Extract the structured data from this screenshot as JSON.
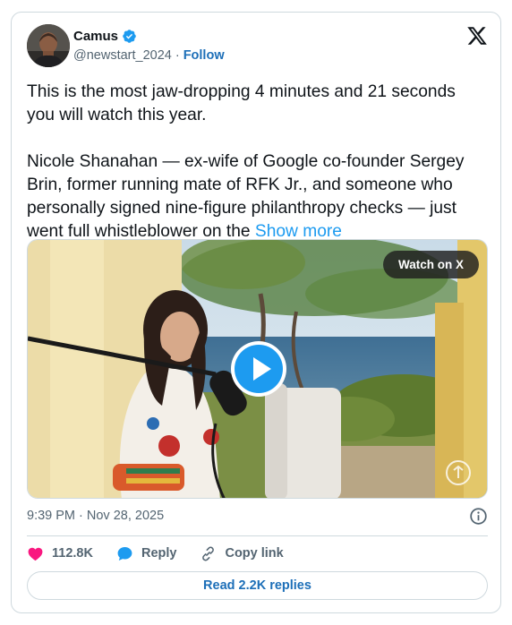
{
  "author": {
    "display_name": "Camus",
    "handle": "@newstart_2024",
    "separator": "·",
    "follow_label": "Follow",
    "verified_color": "#1d9bf0"
  },
  "tweet": {
    "line1": "This is the most jaw-dropping 4 minutes and 21 seconds you will watch this year.",
    "line2": "Nicole Shanahan — ex-wife of Google co-founder Sergey Brin, former running mate of RFK Jr., and someone who personally signed nine-figure philanthropy checks — just went full whistleblower on the",
    "show_more": "Show more"
  },
  "media": {
    "watch_label": "Watch on X",
    "play_color": "#1d9bf0"
  },
  "meta": {
    "timestamp": "9:39 PM · Nov 28, 2025"
  },
  "actions": {
    "likes": "112.8K",
    "reply_label": "Reply",
    "copy_link_label": "Copy link",
    "read_replies_label": "Read 2.2K replies"
  },
  "icons": {
    "like": "heart-icon",
    "reply": "speech-bubble-icon",
    "copy": "link-icon",
    "info": "info-icon",
    "brand": "x-logo-icon"
  },
  "colors": {
    "heart": "#f91880",
    "reply_bubble": "#1d9bf0",
    "link_text": "#1d6fb8"
  }
}
